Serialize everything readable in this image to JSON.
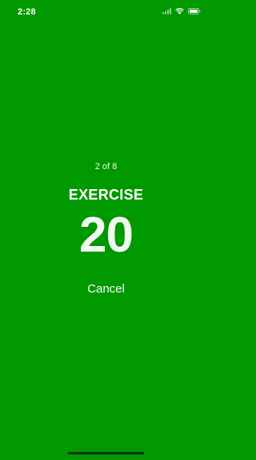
{
  "status_bar": {
    "time": "2:28",
    "icons": [
      "cellular-signal-icon",
      "wifi-icon",
      "battery-icon"
    ]
  },
  "workout": {
    "step_counter": "2 of 8",
    "title": "EXERCISE",
    "countdown": "20",
    "cancel_label": "Cancel"
  },
  "colors": {
    "background": "#009900",
    "text": "#ffffff"
  }
}
